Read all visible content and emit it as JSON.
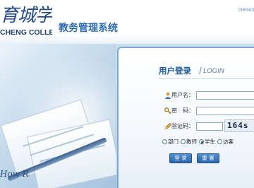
{
  "header": {
    "logo_text": "育城学院",
    "logo_sub": "CHENG COLLEGE",
    "system_title": "教务管理系统",
    "top_right": "ZHENGF"
  },
  "hero": {
    "paper_text": "How Rate"
  },
  "login": {
    "title": "用户登录",
    "separator": "/",
    "subtitle": "LOGIN",
    "fields": {
      "username_label": "用户名：",
      "username_value": "",
      "password_label": "密　码：",
      "password_value": "",
      "captcha_label": "验证码：",
      "captcha_value": "",
      "captcha_text": "164s"
    },
    "roles": [
      {
        "label": "部门",
        "selected": false
      },
      {
        "label": "教师",
        "selected": false
      },
      {
        "label": "学生",
        "selected": true
      },
      {
        "label": "访客",
        "selected": false
      }
    ],
    "login_button": "登 录",
    "reset_button": "重 置"
  },
  "colors": {
    "accent": "#2b6cb0",
    "button": "#2c67ad"
  }
}
